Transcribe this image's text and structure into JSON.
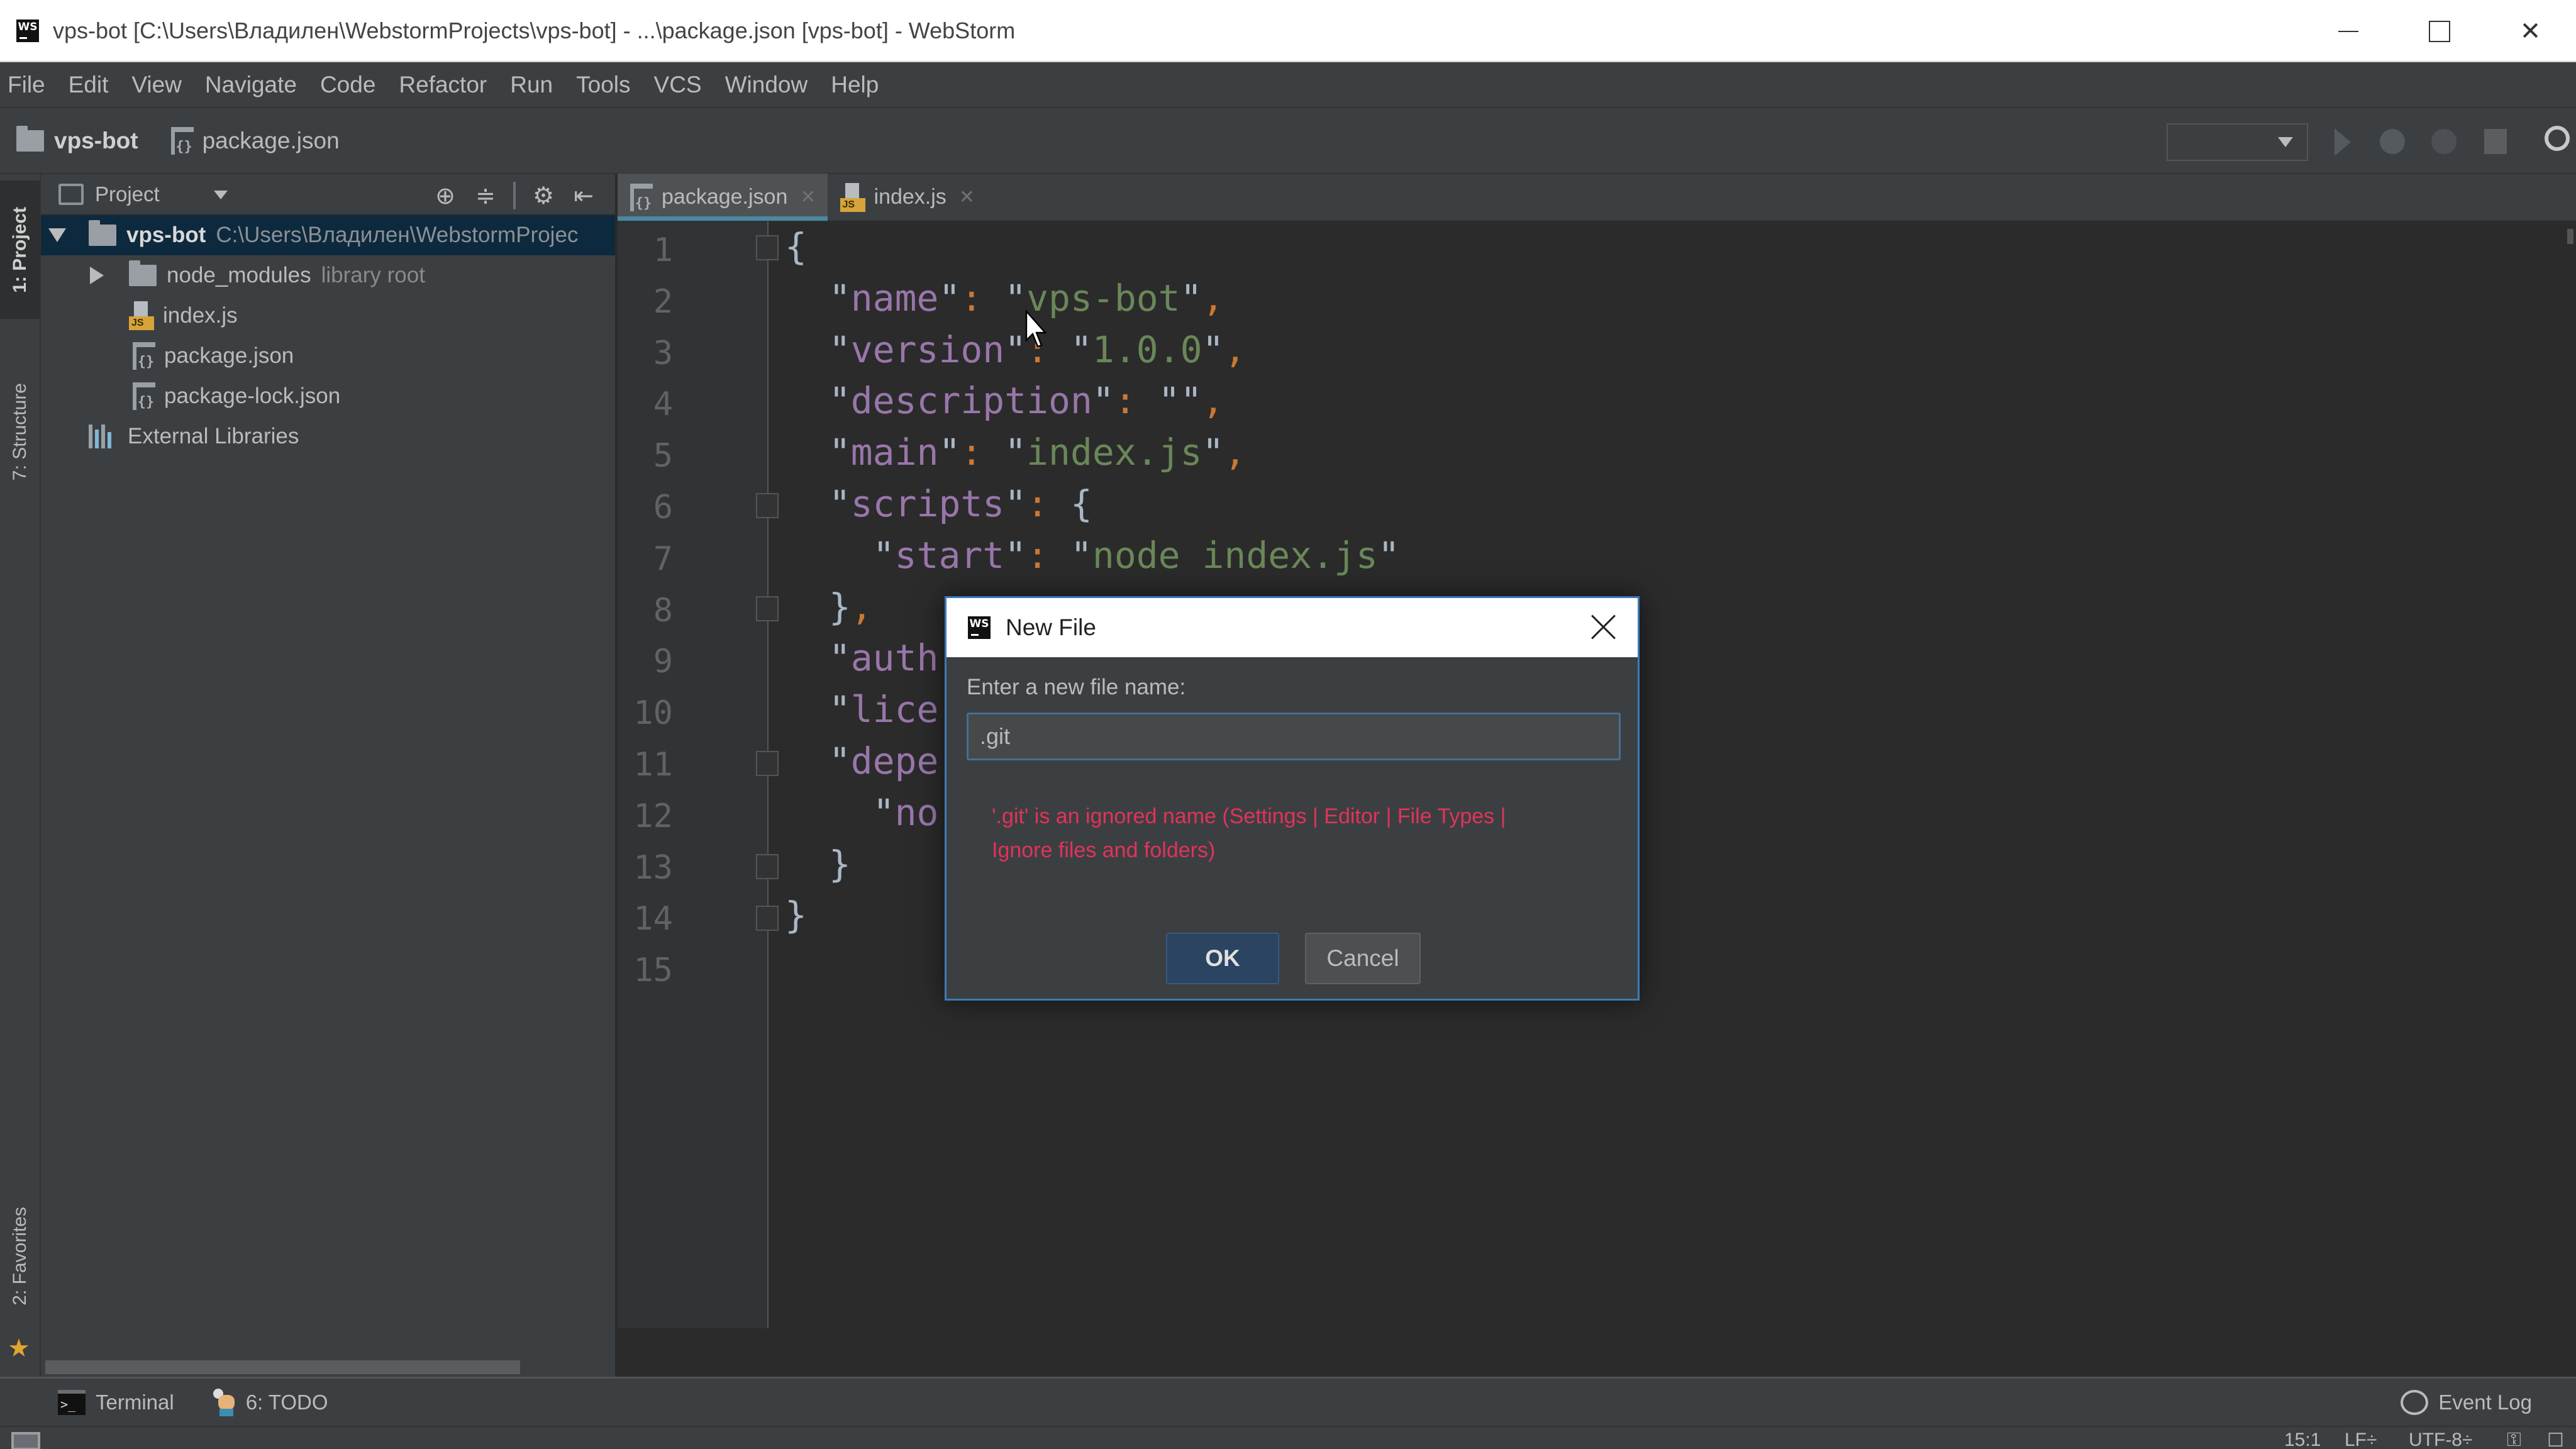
{
  "window": {
    "title": "vps-bot [C:\\Users\\Владилен\\WebstormProjects\\vps-bot] - ...\\package.json [vps-bot] - WebStorm",
    "logo": "WS"
  },
  "menu": [
    "File",
    "Edit",
    "View",
    "Navigate",
    "Code",
    "Refactor",
    "Run",
    "Tools",
    "VCS",
    "Window",
    "Help"
  ],
  "navbar": {
    "project": "vps-bot",
    "file": "package.json"
  },
  "left_stripe": {
    "project": "1: Project",
    "structure": "7: Structure",
    "favorites": "2: Favorites"
  },
  "project_panel": {
    "title": "Project",
    "tree": [
      {
        "name": "vps-bot",
        "hint": "C:\\Users\\Владилен\\WebstormProjec",
        "type": "folder",
        "expanded": true,
        "selected": true
      },
      {
        "name": "node_modules",
        "hint": "library root",
        "type": "folder",
        "expanded": false
      },
      {
        "name": "index.js",
        "type": "js"
      },
      {
        "name": "package.json",
        "type": "json"
      },
      {
        "name": "package-lock.json",
        "type": "json"
      },
      {
        "name": "External Libraries",
        "type": "libraries"
      }
    ]
  },
  "editor": {
    "tabs": [
      {
        "label": "package.json",
        "active": true
      },
      {
        "label": "index.js",
        "active": false
      }
    ],
    "line_numbers": [
      "1",
      "2",
      "3",
      "4",
      "5",
      "6",
      "7",
      "8",
      "9",
      "10",
      "11",
      "12",
      "13",
      "14",
      "15"
    ],
    "lines": [
      "{",
      "  \"name\": \"vps-bot\",",
      "  \"version\": \"1.0.0\",",
      "  \"description\": \"\",",
      "  \"main\": \"index.js\",",
      "  \"scripts\": {",
      "    \"start\": \"node index.js\"",
      "  },",
      "  \"auth",
      "  \"lice",
      "  \"depe",
      "    \"no",
      "  }",
      "}",
      ""
    ],
    "colors": {
      "key": "#9876AA",
      "string": "#6A8759",
      "punct": "#CC7832",
      "text": "#A9B7C6"
    }
  },
  "dialog": {
    "title": "New File",
    "label": "Enter a new file name:",
    "input_value": ".git",
    "error": "'.git' is an ignored name (Settings | Editor | File Types | Ignore files and folders)",
    "ok": "OK",
    "cancel": "Cancel",
    "error_color": "#E0335A"
  },
  "bottom_tools": {
    "terminal": "Terminal",
    "todo": "6: TODO",
    "event_log": "Event Log"
  },
  "status": {
    "position": "15:1",
    "line_sep": "LF÷",
    "encoding": "UTF-8÷"
  }
}
